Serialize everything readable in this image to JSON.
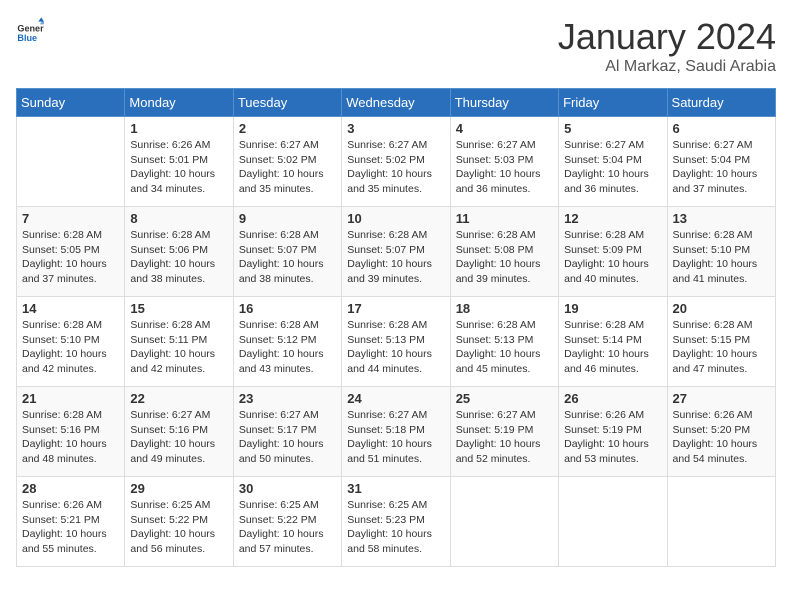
{
  "header": {
    "logo_general": "General",
    "logo_blue": "Blue",
    "month_title": "January 2024",
    "location": "Al Markaz, Saudi Arabia"
  },
  "days_of_week": [
    "Sunday",
    "Monday",
    "Tuesday",
    "Wednesday",
    "Thursday",
    "Friday",
    "Saturday"
  ],
  "weeks": [
    [
      {
        "day": "",
        "info": ""
      },
      {
        "day": "1",
        "info": "Sunrise: 6:26 AM\nSunset: 5:01 PM\nDaylight: 10 hours\nand 34 minutes."
      },
      {
        "day": "2",
        "info": "Sunrise: 6:27 AM\nSunset: 5:02 PM\nDaylight: 10 hours\nand 35 minutes."
      },
      {
        "day": "3",
        "info": "Sunrise: 6:27 AM\nSunset: 5:02 PM\nDaylight: 10 hours\nand 35 minutes."
      },
      {
        "day": "4",
        "info": "Sunrise: 6:27 AM\nSunset: 5:03 PM\nDaylight: 10 hours\nand 36 minutes."
      },
      {
        "day": "5",
        "info": "Sunrise: 6:27 AM\nSunset: 5:04 PM\nDaylight: 10 hours\nand 36 minutes."
      },
      {
        "day": "6",
        "info": "Sunrise: 6:27 AM\nSunset: 5:04 PM\nDaylight: 10 hours\nand 37 minutes."
      }
    ],
    [
      {
        "day": "7",
        "info": "Sunrise: 6:28 AM\nSunset: 5:05 PM\nDaylight: 10 hours\nand 37 minutes."
      },
      {
        "day": "8",
        "info": "Sunrise: 6:28 AM\nSunset: 5:06 PM\nDaylight: 10 hours\nand 38 minutes."
      },
      {
        "day": "9",
        "info": "Sunrise: 6:28 AM\nSunset: 5:07 PM\nDaylight: 10 hours\nand 38 minutes."
      },
      {
        "day": "10",
        "info": "Sunrise: 6:28 AM\nSunset: 5:07 PM\nDaylight: 10 hours\nand 39 minutes."
      },
      {
        "day": "11",
        "info": "Sunrise: 6:28 AM\nSunset: 5:08 PM\nDaylight: 10 hours\nand 39 minutes."
      },
      {
        "day": "12",
        "info": "Sunrise: 6:28 AM\nSunset: 5:09 PM\nDaylight: 10 hours\nand 40 minutes."
      },
      {
        "day": "13",
        "info": "Sunrise: 6:28 AM\nSunset: 5:10 PM\nDaylight: 10 hours\nand 41 minutes."
      }
    ],
    [
      {
        "day": "14",
        "info": "Sunrise: 6:28 AM\nSunset: 5:10 PM\nDaylight: 10 hours\nand 42 minutes."
      },
      {
        "day": "15",
        "info": "Sunrise: 6:28 AM\nSunset: 5:11 PM\nDaylight: 10 hours\nand 42 minutes."
      },
      {
        "day": "16",
        "info": "Sunrise: 6:28 AM\nSunset: 5:12 PM\nDaylight: 10 hours\nand 43 minutes."
      },
      {
        "day": "17",
        "info": "Sunrise: 6:28 AM\nSunset: 5:13 PM\nDaylight: 10 hours\nand 44 minutes."
      },
      {
        "day": "18",
        "info": "Sunrise: 6:28 AM\nSunset: 5:13 PM\nDaylight: 10 hours\nand 45 minutes."
      },
      {
        "day": "19",
        "info": "Sunrise: 6:28 AM\nSunset: 5:14 PM\nDaylight: 10 hours\nand 46 minutes."
      },
      {
        "day": "20",
        "info": "Sunrise: 6:28 AM\nSunset: 5:15 PM\nDaylight: 10 hours\nand 47 minutes."
      }
    ],
    [
      {
        "day": "21",
        "info": "Sunrise: 6:28 AM\nSunset: 5:16 PM\nDaylight: 10 hours\nand 48 minutes."
      },
      {
        "day": "22",
        "info": "Sunrise: 6:27 AM\nSunset: 5:16 PM\nDaylight: 10 hours\nand 49 minutes."
      },
      {
        "day": "23",
        "info": "Sunrise: 6:27 AM\nSunset: 5:17 PM\nDaylight: 10 hours\nand 50 minutes."
      },
      {
        "day": "24",
        "info": "Sunrise: 6:27 AM\nSunset: 5:18 PM\nDaylight: 10 hours\nand 51 minutes."
      },
      {
        "day": "25",
        "info": "Sunrise: 6:27 AM\nSunset: 5:19 PM\nDaylight: 10 hours\nand 52 minutes."
      },
      {
        "day": "26",
        "info": "Sunrise: 6:26 AM\nSunset: 5:19 PM\nDaylight: 10 hours\nand 53 minutes."
      },
      {
        "day": "27",
        "info": "Sunrise: 6:26 AM\nSunset: 5:20 PM\nDaylight: 10 hours\nand 54 minutes."
      }
    ],
    [
      {
        "day": "28",
        "info": "Sunrise: 6:26 AM\nSunset: 5:21 PM\nDaylight: 10 hours\nand 55 minutes."
      },
      {
        "day": "29",
        "info": "Sunrise: 6:25 AM\nSunset: 5:22 PM\nDaylight: 10 hours\nand 56 minutes."
      },
      {
        "day": "30",
        "info": "Sunrise: 6:25 AM\nSunset: 5:22 PM\nDaylight: 10 hours\nand 57 minutes."
      },
      {
        "day": "31",
        "info": "Sunrise: 6:25 AM\nSunset: 5:23 PM\nDaylight: 10 hours\nand 58 minutes."
      },
      {
        "day": "",
        "info": ""
      },
      {
        "day": "",
        "info": ""
      },
      {
        "day": "",
        "info": ""
      }
    ]
  ]
}
